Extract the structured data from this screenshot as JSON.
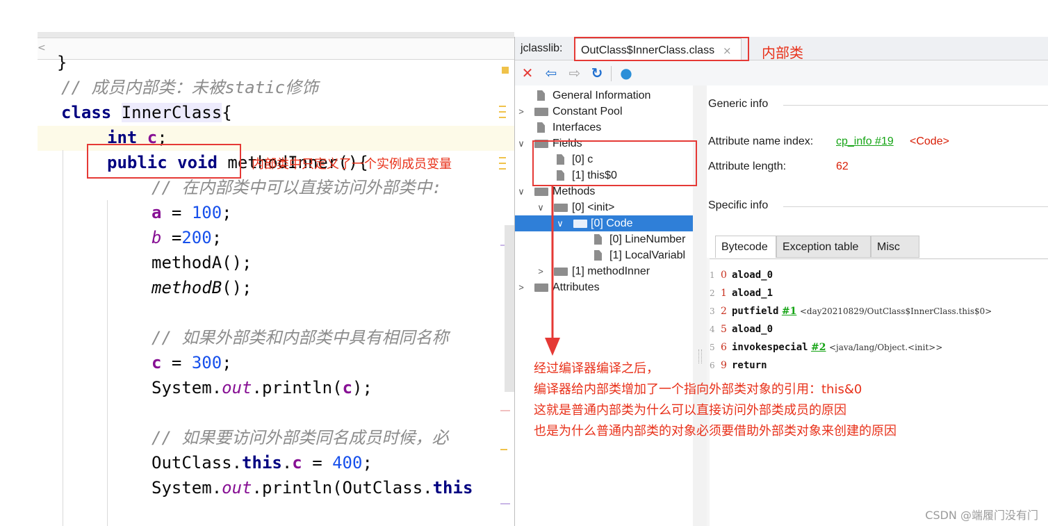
{
  "editor": {
    "scroll_glyph": "<",
    "lines": [
      {
        "parts": [
          {
            "t": "}",
            "c": ""
          }
        ]
      },
      {
        "parts": [
          {
            "t": "// 成员内部类：未被static修饰",
            "c": "cmt"
          }
        ]
      },
      {
        "parts": [
          {
            "t": "class ",
            "c": "kw2"
          },
          {
            "t": "InnerClass",
            "c": ""
          },
          {
            "t": "{",
            "c": ""
          }
        ]
      },
      {
        "parts": [
          {
            "t": "int ",
            "c": "kw2"
          },
          {
            "t": "c",
            "c": "fld"
          },
          {
            "t": ";",
            "c": ""
          }
        ]
      },
      {
        "parts": [
          {
            "t": "public void ",
            "c": "kw2"
          },
          {
            "t": "methodInner(){",
            "c": ""
          }
        ]
      },
      {
        "parts": [
          {
            "t": "// 在内部类中可以直接访问外部类中:",
            "c": "cmt"
          }
        ]
      },
      {
        "parts": [
          {
            "t": "a",
            "c": "fld"
          },
          {
            "t": " = ",
            "c": ""
          },
          {
            "t": "100",
            "c": "num"
          },
          {
            "t": ";",
            "c": ""
          }
        ]
      },
      {
        "parts": [
          {
            "t": "b",
            "c": "stat"
          },
          {
            "t": " =",
            "c": ""
          },
          {
            "t": "200",
            "c": "num"
          },
          {
            "t": ";",
            "c": ""
          }
        ]
      },
      {
        "parts": [
          {
            "t": "methodA();",
            "c": ""
          }
        ]
      },
      {
        "parts": [
          {
            "t": "methodB",
            "c": "ital"
          },
          {
            "t": "();",
            "c": ""
          }
        ]
      },
      {
        "parts": [
          {
            "t": "",
            "c": ""
          }
        ]
      },
      {
        "parts": [
          {
            "t": "// 如果外部类和内部类中具有相同名称",
            "c": "cmt"
          }
        ]
      },
      {
        "parts": [
          {
            "t": "c",
            "c": "fld"
          },
          {
            "t": " = ",
            "c": ""
          },
          {
            "t": "300",
            "c": "num"
          },
          {
            "t": ";",
            "c": ""
          }
        ]
      },
      {
        "parts": [
          {
            "t": "System.",
            "c": ""
          },
          {
            "t": "out",
            "c": "stat"
          },
          {
            "t": ".println(",
            "c": ""
          },
          {
            "t": "c",
            "c": "fld"
          },
          {
            "t": ");",
            "c": ""
          }
        ]
      },
      {
        "parts": [
          {
            "t": "",
            "c": ""
          }
        ]
      },
      {
        "parts": [
          {
            "t": "// 如果要访问外部类同名成员时候，必",
            "c": "cmt"
          }
        ]
      },
      {
        "parts": [
          {
            "t": "OutClass.",
            "c": ""
          },
          {
            "t": "this",
            "c": "kw2"
          },
          {
            "t": ".",
            "c": ""
          },
          {
            "t": "c",
            "c": "fld"
          },
          {
            "t": " = ",
            "c": ""
          },
          {
            "t": "400",
            "c": "num"
          },
          {
            "t": ";",
            "c": ""
          }
        ]
      },
      {
        "parts": [
          {
            "t": "System.",
            "c": ""
          },
          {
            "t": "out",
            "c": "stat"
          },
          {
            "t": ".println(OutClass.",
            "c": ""
          },
          {
            "t": "this",
            "c": "kw2"
          }
        ]
      }
    ]
  },
  "jclasslib": {
    "tab_label": "jclasslib:",
    "active_tab": "OutClass$InnerClass.class",
    "tab_close": "×",
    "toolbar": {
      "close": "✕",
      "back": "⇦",
      "forward": "⇨",
      "refresh": "↻",
      "web": "●"
    },
    "tree": {
      "general": "General Information",
      "constant_pool": "Constant Pool",
      "interfaces": "Interfaces",
      "fields": "Fields",
      "field_0": "[0] c",
      "field_1": "[1] this$0",
      "methods": "Methods",
      "method_0": "[0] <init>",
      "code": "[0] Code",
      "line_number": "[0] LineNumber",
      "local_var": "[1] LocalVariabl",
      "method_1": "[1] methodInner",
      "attributes": "Attributes"
    },
    "detail": {
      "generic_info": "Generic info",
      "attr_name_label": "Attribute name index:",
      "attr_name_link": "cp_info #19",
      "attr_name_value": "<Code>",
      "attr_len_label": "Attribute length:",
      "attr_len_value": "62",
      "specific_info": "Specific info",
      "tabs": [
        "Bytecode",
        "Exception table",
        "Misc"
      ],
      "bytecode": [
        {
          "n": "1",
          "off": "0",
          "op": "aload_0",
          "ref": "",
          "comment": ""
        },
        {
          "n": "2",
          "off": "1",
          "op": "aload_1",
          "ref": "",
          "comment": ""
        },
        {
          "n": "3",
          "off": "2",
          "op": "putfield",
          "ref": "#1",
          "comment": "<day20210829/OutClass$InnerClass.this$0>"
        },
        {
          "n": "4",
          "off": "5",
          "op": "aload_0",
          "ref": "",
          "comment": ""
        },
        {
          "n": "5",
          "off": "6",
          "op": "invokespecial",
          "ref": "#2",
          "comment": "<java/lang/Object.<init>>"
        },
        {
          "n": "6",
          "off": "9",
          "op": "return",
          "ref": "",
          "comment": ""
        }
      ]
    }
  },
  "annotations": {
    "inner_class_label": "内部类",
    "field_note": "内部类中只定义了一个实例成员变量",
    "compile_note": [
      "经过编译器编译之后，",
      "编译器给内部类增加了一个指向外部类对象的引用：this&0",
      "这就是普通内部类为什么可以直接访问外部类成员的原因",
      "也是为什么普通内部类的对象必须要借助外部类对象来创建的原因"
    ]
  },
  "watermark": "CSDN @端履门没有门"
}
